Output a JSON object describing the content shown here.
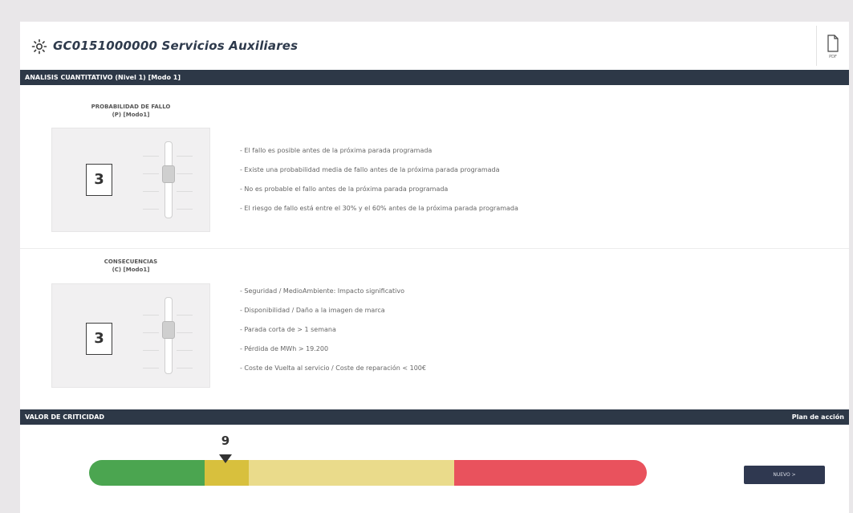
{
  "header": {
    "title": "GC0151000000 Servicios Auxiliares",
    "title_icon": "sun-icon",
    "pdf_icon": "pdf-file-icon",
    "pdf_label": "PDF"
  },
  "analysis_bar": {
    "label": "ANALISIS CUANTITATIVO (Nivel 1) [Modo 1]"
  },
  "probability": {
    "title_line1": "PROBABILIDAD DE FALLO",
    "title_line2": "(P) [Modo1]",
    "value": "3",
    "items": [
      "- El fallo es posible antes de la próxima parada programada",
      "- Existe una probabilidad media de fallo antes de la próxima parada programada",
      "- No es probable el fallo antes de la próxima parada programada",
      "- El riesgo de fallo está entre el 30% y el 60% antes de la próxima parada programada"
    ]
  },
  "consequences": {
    "title_line1": "CONSECUENCIAS",
    "title_line2": "(C) [Modo1]",
    "value": "3",
    "items": [
      "- Seguridad / MedioAmbiente: Impacto significativo",
      "- Disponibilidad / Daño a la imagen de marca",
      "- Parada corta de > 1 semana",
      "- Pérdida de MWh > 19.200",
      "- Coste de Vuelta al servicio / Coste de reparación < 100€"
    ]
  },
  "criticality_bar": {
    "label": "VALOR DE CRITICIDAD",
    "action_link": "Plan de acción"
  },
  "criticality": {
    "value": "9",
    "colors": {
      "green": "#4ba550",
      "dark_yellow": "#d8c03d",
      "light_yellow": "#eadb8b",
      "red": "#e9525d"
    }
  },
  "next_button": {
    "label": "NUEVO >"
  }
}
